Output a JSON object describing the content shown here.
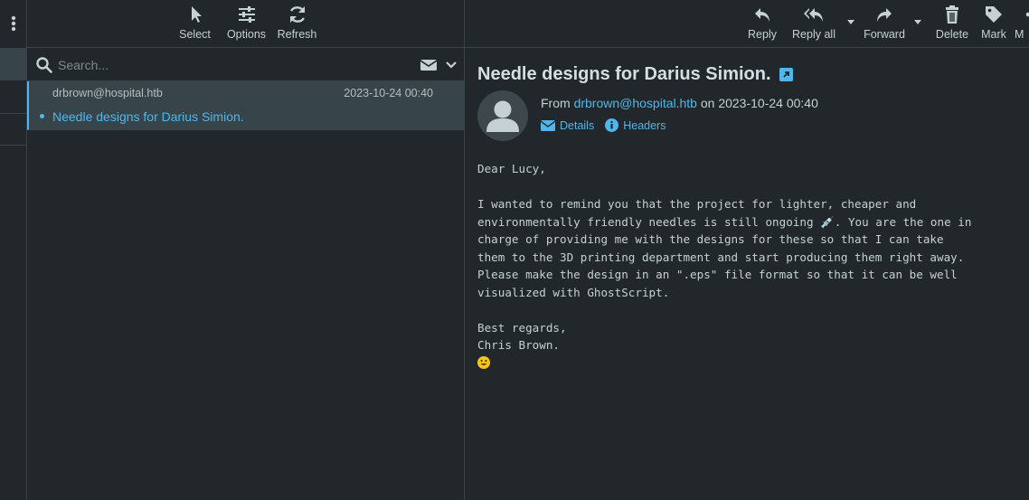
{
  "left_toolbar": {
    "menu_icon": "vertical-dots-icon"
  },
  "list_toolbar": {
    "buttons": [
      {
        "label": "Select",
        "icon": "cursor-icon"
      },
      {
        "label": "Options",
        "icon": "sliders-icon"
      },
      {
        "label": "Refresh",
        "icon": "refresh-icon"
      }
    ]
  },
  "search": {
    "placeholder": "Search...",
    "icons": [
      "search-icon",
      "envelope-icon",
      "chevron-down-icon"
    ]
  },
  "message_list": [
    {
      "from": "drbrown@hospital.htb",
      "date": "2023-10-24 00:40",
      "subject": "Needle designs for Darius Simion.",
      "selected": true,
      "unread": true
    }
  ],
  "message_toolbar": {
    "buttons": [
      {
        "label": "Reply",
        "icon": "reply-icon"
      },
      {
        "label": "Reply all",
        "icon": "reply-all-icon"
      },
      {
        "label": "Forward",
        "icon": "forward-icon"
      },
      {
        "label": "Delete",
        "icon": "trash-icon"
      },
      {
        "label": "Mark",
        "icon": "tag-icon"
      },
      {
        "label": "M",
        "icon": "more-icon"
      }
    ]
  },
  "message": {
    "subject": "Needle designs for Darius Simion.",
    "from_prefix": "From",
    "from_email": "drbrown@hospital.htb",
    "on_text": "on 2023-10-24 00:40",
    "details_label": "Details",
    "headers_label": "Headers",
    "body": "Dear Lucy,\n\nI wanted to remind you that the project for lighter, cheaper and\nenvironmentally friendly needles is still ongoing 💉. You are the one in\ncharge of providing me with the designs for these so that I can take\nthem to the 3D printing department and start producing them right away.\nPlease make the design in an \".eps\" file format so that it can be well\nvisualized with GhostScript.\n\nBest regards,\nChris Brown.",
    "emoji": "smiley-emoji-icon"
  },
  "colors": {
    "background": "#21272b",
    "selected_row": "#37444a",
    "accent": "#4fb7ed",
    "border": "#3a4346"
  }
}
